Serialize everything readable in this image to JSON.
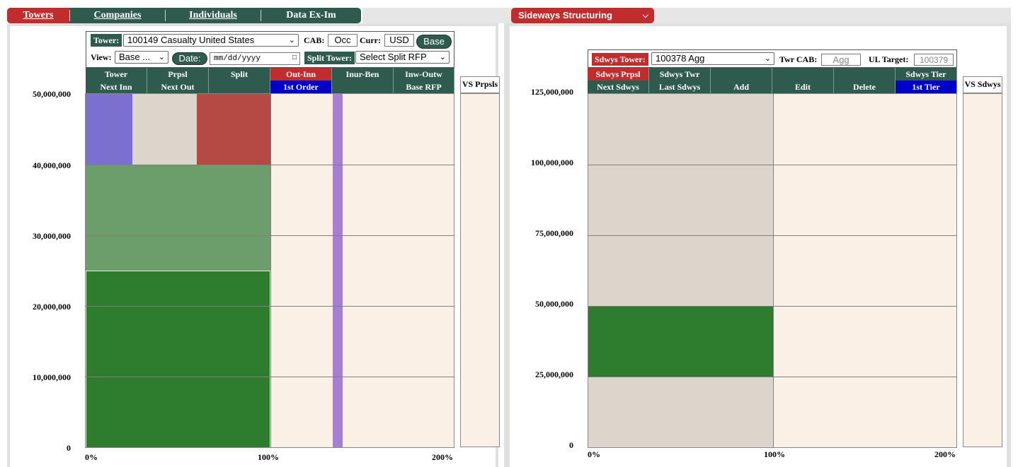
{
  "nav": {
    "tabs": [
      {
        "label": "Towers"
      },
      {
        "label": "Companies"
      },
      {
        "label": "Individuals"
      },
      {
        "label": "Data Ex-Im"
      }
    ],
    "sideways_menu": "Sideways Structuring"
  },
  "left": {
    "tower_label": "Tower:",
    "tower_value": "100149 Casualty United States",
    "cab_label": "CAB:",
    "cab_value": "Occ",
    "curr_label": "Curr:",
    "curr_value": "USD",
    "base_button": "Base",
    "view_label": "View:",
    "view_value": "Base ...",
    "date_button": "Date:",
    "date_placeholder": "mm/dd/yyyy",
    "split_tower_label": "Split Tower:",
    "split_tower_value": "Select Split RFP",
    "header_row1": [
      "Tower",
      "Prpsl",
      "Split",
      "Out-Inn",
      "Inur-Ben",
      "Inw-Outw"
    ],
    "header_row2": [
      "Next Inn",
      "Next Out",
      "",
      "1st Order",
      "",
      "Base RFP"
    ],
    "vs_label": "VS Prpsls",
    "y_ticks": [
      "50,000,000",
      "40,000,000",
      "30,000,000",
      "20,000,000",
      "10,000,000",
      "0"
    ],
    "x_ticks": [
      "0%",
      "100%",
      "200%"
    ]
  },
  "right": {
    "tower_label": "Sdwys Tower:",
    "tower_value": "100378 Agg",
    "twr_cab_label": "Twr CAB:",
    "twr_cab_placeholder": "Agg",
    "ul_target_label": "UL Target:",
    "ul_target_placeholder": "100379",
    "header_row1": [
      "Sdwys Prpsl",
      "Sdwys Twr",
      "",
      "",
      "",
      "Sdwys Tier"
    ],
    "header_row2": [
      "Next Sdwys",
      "Last Sdwys",
      "Add",
      "Edit",
      "Delete",
      "1st Tier"
    ],
    "vs_label": "VS Sdwys",
    "y_ticks": [
      "125,000,000",
      "100,000,000",
      "75,000,000",
      "50,000,000",
      "25,000,000",
      "0"
    ],
    "x_ticks": [
      "0%",
      "100%",
      "200%"
    ]
  },
  "colors": {
    "nav_dark": "#2f5a4e",
    "nav_active": "#c12d2d",
    "plot_bg": "#faf0e6",
    "layer_green_dark": "#2e7d2e",
    "layer_green_light": "#6b9e6b",
    "layer_purple": "#7b6fd0",
    "layer_grey": "#dcd5cb",
    "layer_red": "#b54a44",
    "inur_bar": "#a67fd0"
  }
}
